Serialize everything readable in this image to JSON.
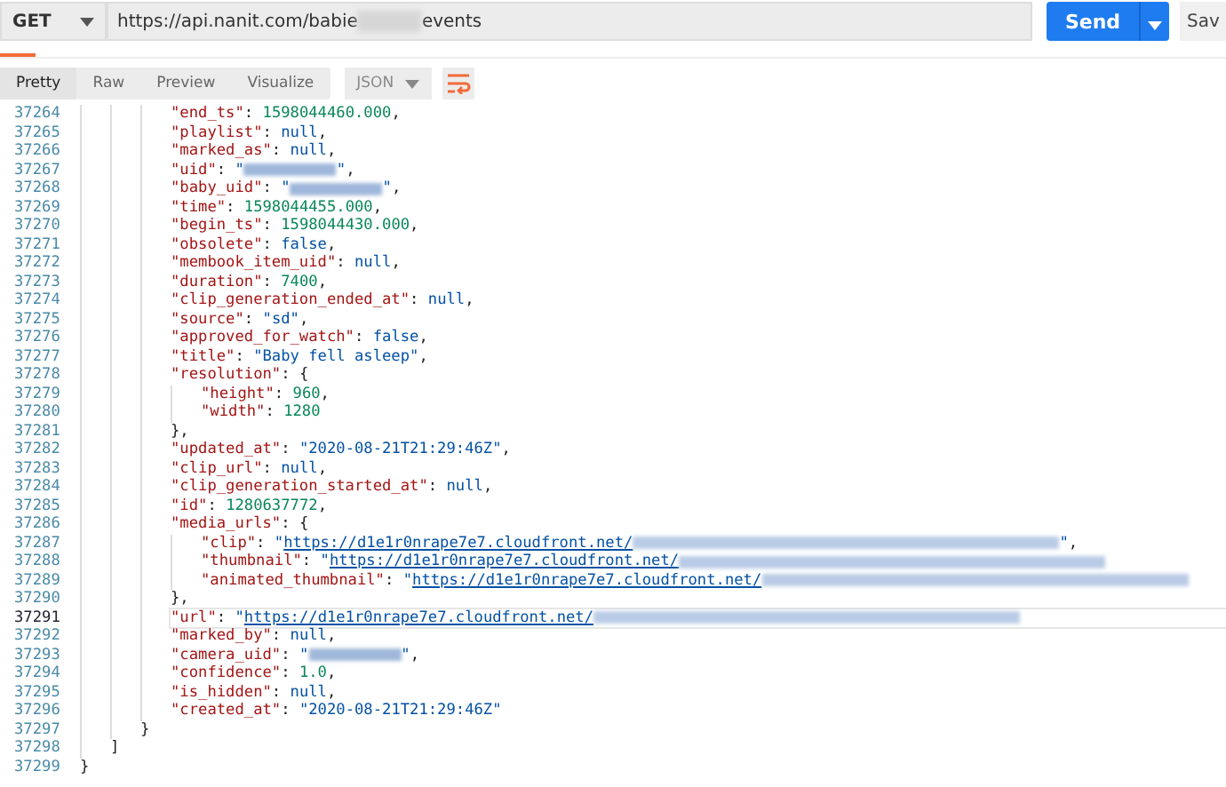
{
  "request": {
    "method": "GET",
    "url_parts": [
      {
        "kind": "text",
        "text": "https://api.nanit.com/babie"
      },
      {
        "kind": "redacted"
      },
      {
        "kind": "text",
        "text": "events"
      }
    ],
    "send": "Send",
    "save": "Sav"
  },
  "view_tabs": [
    {
      "label": "Pretty",
      "selected": true
    },
    {
      "label": "Raw",
      "selected": false
    },
    {
      "label": "Preview",
      "selected": false
    },
    {
      "label": "Visualize",
      "selected": false
    }
  ],
  "format": "JSON",
  "lines": [
    {
      "children": [
        {
          "children": [
            {
              "children": [
                {
                  "number": "37264",
                  "selected": false,
                  "tokens": [
                    {
                      "kind": "key",
                      "text": "\"end_ts\""
                    },
                    {
                      "kind": "punct",
                      "text": ": "
                    },
                    {
                      "kind": "number",
                      "text": "1598044460.000"
                    },
                    {
                      "kind": "punct",
                      "text": ","
                    }
                  ]
                },
                {
                  "number": "37265",
                  "selected": false,
                  "tokens": [
                    {
                      "kind": "key",
                      "text": "\"playlist\""
                    },
                    {
                      "kind": "punct",
                      "text": ": "
                    },
                    {
                      "kind": "literal",
                      "text": "null"
                    },
                    {
                      "kind": "punct",
                      "text": ","
                    }
                  ]
                },
                {
                  "number": "37266",
                  "selected": false,
                  "tokens": [
                    {
                      "kind": "key",
                      "text": "\"marked_as\""
                    },
                    {
                      "kind": "punct",
                      "text": ": "
                    },
                    {
                      "kind": "literal",
                      "text": "null"
                    },
                    {
                      "kind": "punct",
                      "text": ","
                    }
                  ]
                },
                {
                  "number": "37267",
                  "selected": false,
                  "tokens": [
                    {
                      "kind": "key",
                      "text": "\"uid\""
                    },
                    {
                      "kind": "punct",
                      "text": ": "
                    },
                    {
                      "kind": "string",
                      "text": "\""
                    },
                    {
                      "kind": "redacted"
                    },
                    {
                      "kind": "string",
                      "text": "\""
                    },
                    {
                      "kind": "punct",
                      "text": ","
                    }
                  ]
                },
                {
                  "number": "37268",
                  "selected": false,
                  "tokens": [
                    {
                      "kind": "key",
                      "text": "\"baby_uid\""
                    },
                    {
                      "kind": "punct",
                      "text": ": "
                    },
                    {
                      "kind": "string",
                      "text": "\""
                    },
                    {
                      "kind": "redacted"
                    },
                    {
                      "kind": "string",
                      "text": "\""
                    },
                    {
                      "kind": "punct",
                      "text": ","
                    }
                  ]
                },
                {
                  "number": "37269",
                  "selected": false,
                  "tokens": [
                    {
                      "kind": "key",
                      "text": "\"time\""
                    },
                    {
                      "kind": "punct",
                      "text": ": "
                    },
                    {
                      "kind": "number",
                      "text": "1598044455.000"
                    },
                    {
                      "kind": "punct",
                      "text": ","
                    }
                  ]
                },
                {
                  "number": "37270",
                  "selected": false,
                  "tokens": [
                    {
                      "kind": "key",
                      "text": "\"begin_ts\""
                    },
                    {
                      "kind": "punct",
                      "text": ": "
                    },
                    {
                      "kind": "number",
                      "text": "1598044430.000"
                    },
                    {
                      "kind": "punct",
                      "text": ","
                    }
                  ]
                },
                {
                  "number": "37271",
                  "selected": false,
                  "tokens": [
                    {
                      "kind": "key",
                      "text": "\"obsolete\""
                    },
                    {
                      "kind": "punct",
                      "text": ": "
                    },
                    {
                      "kind": "literal",
                      "text": "false"
                    },
                    {
                      "kind": "punct",
                      "text": ","
                    }
                  ]
                },
                {
                  "number": "37272",
                  "selected": false,
                  "tokens": [
                    {
                      "kind": "key",
                      "text": "\"membook_item_uid\""
                    },
                    {
                      "kind": "punct",
                      "text": ": "
                    },
                    {
                      "kind": "literal",
                      "text": "null"
                    },
                    {
                      "kind": "punct",
                      "text": ","
                    }
                  ]
                },
                {
                  "number": "37273",
                  "selected": false,
                  "tokens": [
                    {
                      "kind": "key",
                      "text": "\"duration\""
                    },
                    {
                      "kind": "punct",
                      "text": ": "
                    },
                    {
                      "kind": "number",
                      "text": "7400"
                    },
                    {
                      "kind": "punct",
                      "text": ","
                    }
                  ]
                },
                {
                  "number": "37274",
                  "selected": false,
                  "tokens": [
                    {
                      "kind": "key",
                      "text": "\"clip_generation_ended_at\""
                    },
                    {
                      "kind": "punct",
                      "text": ": "
                    },
                    {
                      "kind": "literal",
                      "text": "null"
                    },
                    {
                      "kind": "punct",
                      "text": ","
                    }
                  ]
                },
                {
                  "number": "37275",
                  "selected": false,
                  "tokens": [
                    {
                      "kind": "key",
                      "text": "\"source\""
                    },
                    {
                      "kind": "punct",
                      "text": ": "
                    },
                    {
                      "kind": "string",
                      "text": "\"sd\""
                    },
                    {
                      "kind": "punct",
                      "text": ","
                    }
                  ]
                },
                {
                  "number": "37276",
                  "selected": false,
                  "tokens": [
                    {
                      "kind": "key",
                      "text": "\"approved_for_watch\""
                    },
                    {
                      "kind": "punct",
                      "text": ": "
                    },
                    {
                      "kind": "literal",
                      "text": "false"
                    },
                    {
                      "kind": "punct",
                      "text": ","
                    }
                  ]
                },
                {
                  "number": "37277",
                  "selected": false,
                  "tokens": [
                    {
                      "kind": "key",
                      "text": "\"title\""
                    },
                    {
                      "kind": "punct",
                      "text": ": "
                    },
                    {
                      "kind": "string",
                      "text": "\"Baby fell asleep\""
                    },
                    {
                      "kind": "punct",
                      "text": ","
                    }
                  ]
                },
                {
                  "number": "37278",
                  "selected": false,
                  "tokens": [
                    {
                      "kind": "key",
                      "text": "\"resolution\""
                    },
                    {
                      "kind": "punct",
                      "text": ": {"
                    }
                  ]
                },
                {
                  "children": [
                    {
                      "number": "37279",
                      "selected": false,
                      "tokens": [
                        {
                          "kind": "key",
                          "text": "\"height\""
                        },
                        {
                          "kind": "punct",
                          "text": ": "
                        },
                        {
                          "kind": "number",
                          "text": "960"
                        },
                        {
                          "kind": "punct",
                          "text": ","
                        }
                      ]
                    },
                    {
                      "number": "37280",
                      "selected": false,
                      "tokens": [
                        {
                          "kind": "key",
                          "text": "\"width\""
                        },
                        {
                          "kind": "punct",
                          "text": ": "
                        },
                        {
                          "kind": "number",
                          "text": "1280"
                        }
                      ]
                    }
                  ]
                },
                {
                  "number": "37281",
                  "selected": false,
                  "tokens": [
                    {
                      "kind": "punct",
                      "text": "},"
                    }
                  ]
                },
                {
                  "number": "37282",
                  "selected": false,
                  "tokens": [
                    {
                      "kind": "key",
                      "text": "\"updated_at\""
                    },
                    {
                      "kind": "punct",
                      "text": ": "
                    },
                    {
                      "kind": "string",
                      "text": "\"2020-08-21T21:29:46Z\""
                    },
                    {
                      "kind": "punct",
                      "text": ","
                    }
                  ]
                },
                {
                  "number": "37283",
                  "selected": false,
                  "tokens": [
                    {
                      "kind": "key",
                      "text": "\"clip_url\""
                    },
                    {
                      "kind": "punct",
                      "text": ": "
                    },
                    {
                      "kind": "literal",
                      "text": "null"
                    },
                    {
                      "kind": "punct",
                      "text": ","
                    }
                  ]
                },
                {
                  "number": "37284",
                  "selected": false,
                  "tokens": [
                    {
                      "kind": "key",
                      "text": "\"clip_generation_started_at\""
                    },
                    {
                      "kind": "punct",
                      "text": ": "
                    },
                    {
                      "kind": "literal",
                      "text": "null"
                    },
                    {
                      "kind": "punct",
                      "text": ","
                    }
                  ]
                },
                {
                  "number": "37285",
                  "selected": false,
                  "tokens": [
                    {
                      "kind": "key",
                      "text": "\"id\""
                    },
                    {
                      "kind": "punct",
                      "text": ": "
                    },
                    {
                      "kind": "number",
                      "text": "1280637772"
                    },
                    {
                      "kind": "punct",
                      "text": ","
                    }
                  ]
                },
                {
                  "number": "37286",
                  "selected": false,
                  "tokens": [
                    {
                      "kind": "key",
                      "text": "\"media_urls\""
                    },
                    {
                      "kind": "punct",
                      "text": ": {"
                    }
                  ]
                },
                {
                  "children": [
                    {
                      "number": "37287",
                      "selected": false,
                      "tokens": [
                        {
                          "kind": "key",
                          "text": "\"clip\""
                        },
                        {
                          "kind": "punct",
                          "text": ": "
                        },
                        {
                          "kind": "string",
                          "text": "\""
                        },
                        {
                          "kind": "link",
                          "text": "https://d1e1r0nrape7e7.cloudfront.net/"
                        },
                        {
                          "kind": "redacted_link"
                        },
                        {
                          "kind": "string",
                          "text": "\""
                        },
                        {
                          "kind": "punct",
                          "text": ","
                        }
                      ]
                    },
                    {
                      "number": "37288",
                      "selected": false,
                      "tokens": [
                        {
                          "kind": "key",
                          "text": "\"thumbnail\""
                        },
                        {
                          "kind": "punct",
                          "text": ": "
                        },
                        {
                          "kind": "string",
                          "text": "\""
                        },
                        {
                          "kind": "link",
                          "text": "https://d1e1r0nrape7e7.cloudfront.net/"
                        },
                        {
                          "kind": "redacted_link"
                        }
                      ]
                    },
                    {
                      "number": "37289",
                      "selected": false,
                      "tokens": [
                        {
                          "kind": "key",
                          "text": "\"animated_thumbnail\""
                        },
                        {
                          "kind": "punct",
                          "text": ": "
                        },
                        {
                          "kind": "string",
                          "text": "\""
                        },
                        {
                          "kind": "link",
                          "text": "https://d1e1r0nrape7e7.cloudfront.net/"
                        },
                        {
                          "kind": "redacted_link"
                        }
                      ]
                    }
                  ]
                },
                {
                  "number": "37290",
                  "selected": false,
                  "tokens": [
                    {
                      "kind": "punct",
                      "text": "},"
                    }
                  ]
                },
                {
                  "number": "37291",
                  "selected": true,
                  "tokens": [
                    {
                      "kind": "key",
                      "text": "\"url\""
                    },
                    {
                      "kind": "punct",
                      "text": ": "
                    },
                    {
                      "kind": "string",
                      "text": "\""
                    },
                    {
                      "kind": "link",
                      "text": "https://d1e1r0nrape7e7.cloudfront.net/"
                    },
                    {
                      "kind": "redacted_link"
                    }
                  ]
                },
                {
                  "number": "37292",
                  "selected": false,
                  "tokens": [
                    {
                      "kind": "key",
                      "text": "\"marked_by\""
                    },
                    {
                      "kind": "punct",
                      "text": ": "
                    },
                    {
                      "kind": "literal",
                      "text": "null"
                    },
                    {
                      "kind": "punct",
                      "text": ","
                    }
                  ]
                },
                {
                  "number": "37293",
                  "selected": false,
                  "tokens": [
                    {
                      "kind": "key",
                      "text": "\"camera_uid\""
                    },
                    {
                      "kind": "punct",
                      "text": ": "
                    },
                    {
                      "kind": "string",
                      "text": "\""
                    },
                    {
                      "kind": "redacted"
                    },
                    {
                      "kind": "string",
                      "text": "\""
                    },
                    {
                      "kind": "punct",
                      "text": ","
                    }
                  ]
                },
                {
                  "number": "37294",
                  "selected": false,
                  "tokens": [
                    {
                      "kind": "key",
                      "text": "\"confidence\""
                    },
                    {
                      "kind": "punct",
                      "text": ": "
                    },
                    {
                      "kind": "number",
                      "text": "1.0"
                    },
                    {
                      "kind": "punct",
                      "text": ","
                    }
                  ]
                },
                {
                  "number": "37295",
                  "selected": false,
                  "tokens": [
                    {
                      "kind": "key",
                      "text": "\"is_hidden\""
                    },
                    {
                      "kind": "punct",
                      "text": ": "
                    },
                    {
                      "kind": "literal",
                      "text": "null"
                    },
                    {
                      "kind": "punct",
                      "text": ","
                    }
                  ]
                },
                {
                  "number": "37296",
                  "selected": false,
                  "tokens": [
                    {
                      "kind": "key",
                      "text": "\"created_at\""
                    },
                    {
                      "kind": "punct",
                      "text": ": "
                    },
                    {
                      "kind": "string",
                      "text": "\"2020-08-21T21:29:46Z\""
                    }
                  ]
                }
              ]
            },
            {
              "number": "37297",
              "selected": false,
              "tokens": [
                {
                  "kind": "punct",
                  "text": "}"
                }
              ]
            }
          ]
        },
        {
          "number": "37298",
          "selected": false,
          "tokens": [
            {
              "kind": "punct",
              "text": "]"
            }
          ]
        }
      ]
    },
    {
      "number": "37299",
      "selected": false,
      "tokens": [
        {
          "kind": "punct",
          "text": "}"
        }
      ]
    }
  ]
}
